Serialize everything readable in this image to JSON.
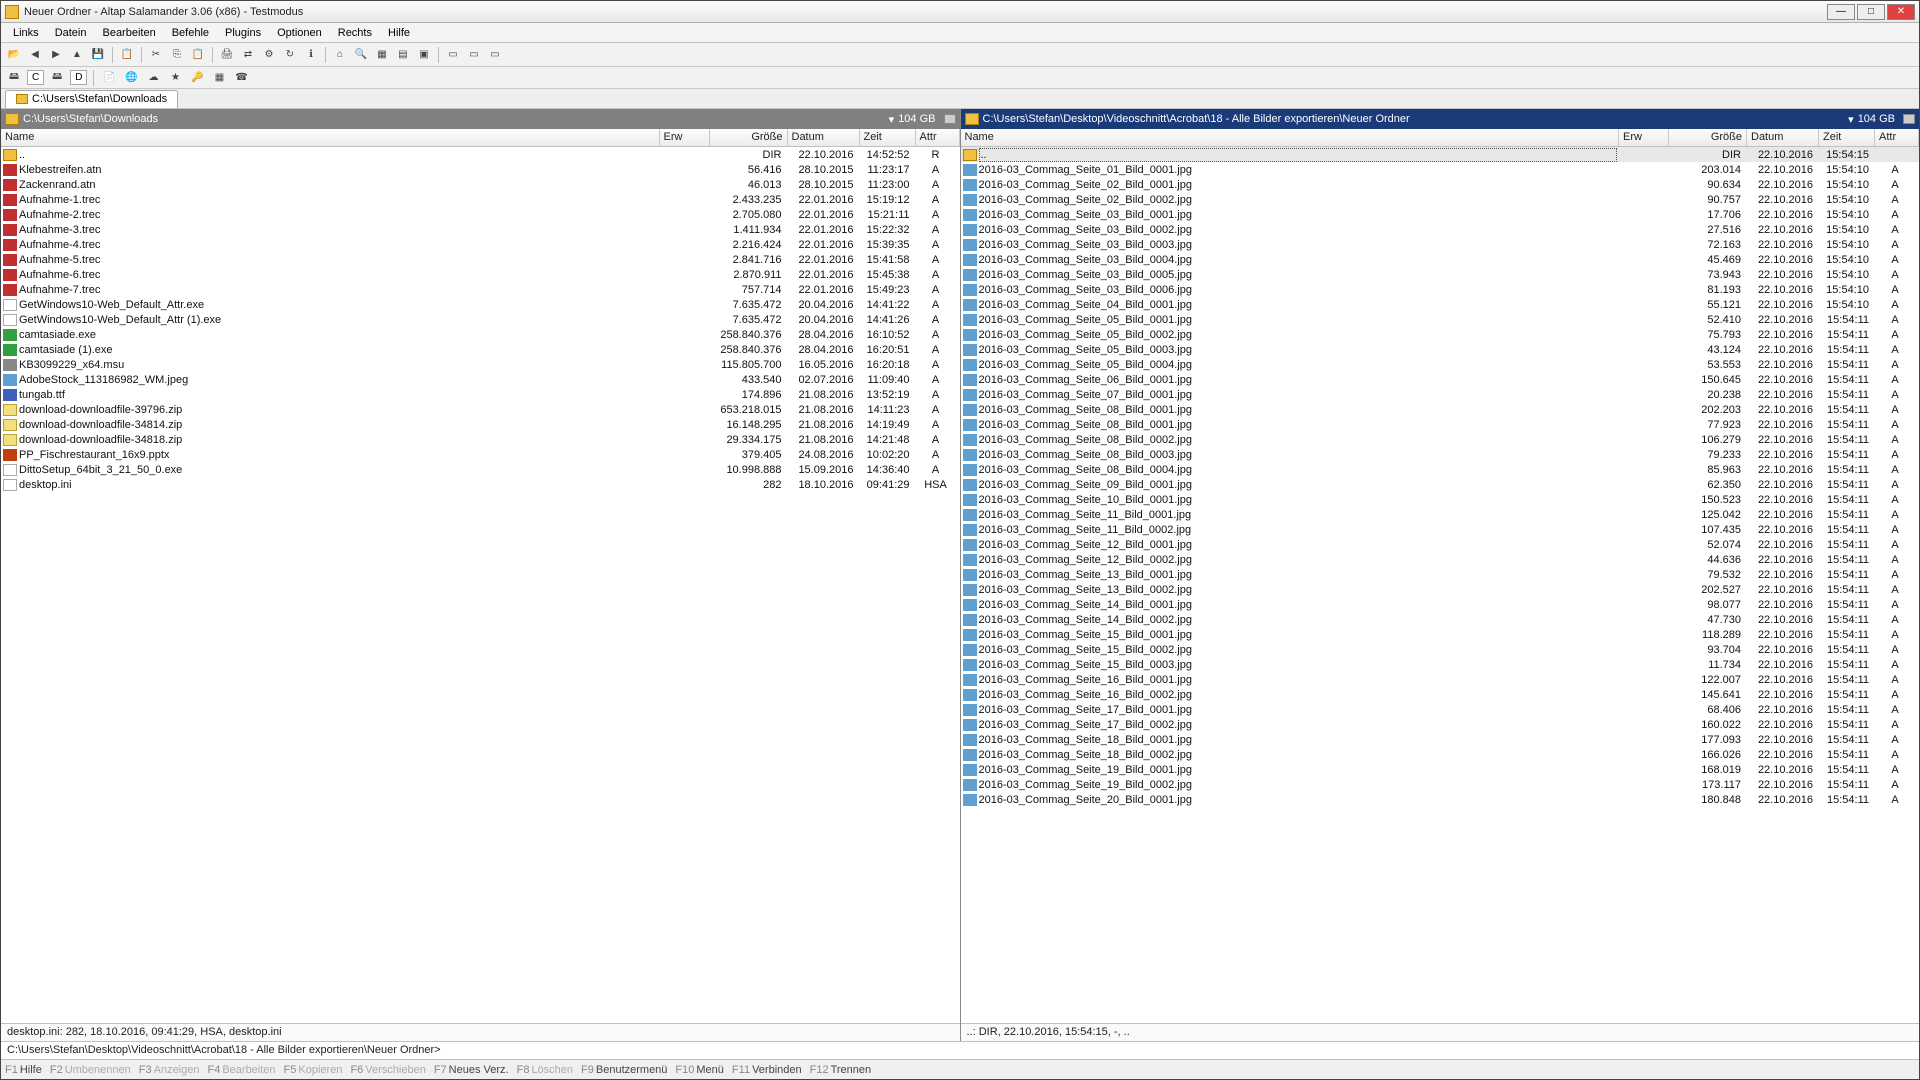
{
  "title": "Neuer Ordner - Altap Salamander 3.06 (x86) - Testmodus",
  "menu": [
    "Links",
    "Datein",
    "Bearbeiten",
    "Befehle",
    "Plugins",
    "Optionen",
    "Rechts",
    "Hilfe"
  ],
  "drives": [
    "C",
    "D"
  ],
  "tab_left": "C:\\Users\\Stefan\\Downloads",
  "left": {
    "path": "C:\\Users\\Stefan\\Downloads",
    "free": "104 GB",
    "cols": [
      "Name",
      "Erw",
      "Größe",
      "Datum",
      "Zeit",
      "Attr"
    ],
    "rows": [
      {
        "ic": "up",
        "nm": "..",
        "sz": "DIR",
        "dt": "22.10.2016",
        "tm": "14:52:52",
        "at": "R"
      },
      {
        "ic": "red",
        "nm": "Klebestreifen.atn",
        "sz": "56.416",
        "dt": "28.10.2015",
        "tm": "11:23:17",
        "at": "A"
      },
      {
        "ic": "red",
        "nm": "Zackenrand.atn",
        "sz": "46.013",
        "dt": "28.10.2015",
        "tm": "11:23:00",
        "at": "A"
      },
      {
        "ic": "red",
        "nm": "Aufnahme-1.trec",
        "sz": "2.433.235",
        "dt": "22.01.2016",
        "tm": "15:19:12",
        "at": "A"
      },
      {
        "ic": "red",
        "nm": "Aufnahme-2.trec",
        "sz": "2.705.080",
        "dt": "22.01.2016",
        "tm": "15:21:11",
        "at": "A"
      },
      {
        "ic": "red",
        "nm": "Aufnahme-3.trec",
        "sz": "1.411.934",
        "dt": "22.01.2016",
        "tm": "15:22:32",
        "at": "A"
      },
      {
        "ic": "red",
        "nm": "Aufnahme-4.trec",
        "sz": "2.216.424",
        "dt": "22.01.2016",
        "tm": "15:39:35",
        "at": "A"
      },
      {
        "ic": "red",
        "nm": "Aufnahme-5.trec",
        "sz": "2.841.716",
        "dt": "22.01.2016",
        "tm": "15:41:58",
        "at": "A"
      },
      {
        "ic": "red",
        "nm": "Aufnahme-6.trec",
        "sz": "2.870.911",
        "dt": "22.01.2016",
        "tm": "15:45:38",
        "at": "A"
      },
      {
        "ic": "red",
        "nm": "Aufnahme-7.trec",
        "sz": "757.714",
        "dt": "22.01.2016",
        "tm": "15:49:23",
        "at": "A"
      },
      {
        "ic": "white",
        "nm": "GetWindows10-Web_Default_Attr.exe",
        "sz": "7.635.472",
        "dt": "20.04.2016",
        "tm": "14:41:22",
        "at": "A"
      },
      {
        "ic": "white",
        "nm": "GetWindows10-Web_Default_Attr (1).exe",
        "sz": "7.635.472",
        "dt": "20.04.2016",
        "tm": "14:41:26",
        "at": "A"
      },
      {
        "ic": "green",
        "nm": "camtasiade.exe",
        "sz": "258.840.376",
        "dt": "28.04.2016",
        "tm": "16:10:52",
        "at": "A"
      },
      {
        "ic": "green",
        "nm": "camtasiade (1).exe",
        "sz": "258.840.376",
        "dt": "28.04.2016",
        "tm": "16:20:51",
        "at": "A"
      },
      {
        "ic": "wrench",
        "nm": "KB3099229_x64.msu",
        "sz": "115.805.700",
        "dt": "16.05.2016",
        "tm": "16:20:18",
        "at": "A"
      },
      {
        "ic": "img",
        "nm": "AdobeStock_113186982_WM.jpeg",
        "sz": "433.540",
        "dt": "02.07.2016",
        "tm": "11:09:40",
        "at": "A"
      },
      {
        "ic": "blue",
        "nm": "tungab.ttf",
        "sz": "174.896",
        "dt": "21.08.2016",
        "tm": "13:52:19",
        "at": "A"
      },
      {
        "ic": "zip",
        "nm": "download-downloadfile-39796.zip",
        "sz": "653.218.015",
        "dt": "21.08.2016",
        "tm": "14:11:23",
        "at": "A"
      },
      {
        "ic": "zip",
        "nm": "download-downloadfile-34814.zip",
        "sz": "16.148.295",
        "dt": "21.08.2016",
        "tm": "14:19:49",
        "at": "A"
      },
      {
        "ic": "zip",
        "nm": "download-downloadfile-34818.zip",
        "sz": "29.334.175",
        "dt": "21.08.2016",
        "tm": "14:21:48",
        "at": "A"
      },
      {
        "ic": "pp",
        "nm": "PP_Fischrestaurant_16x9.pptx",
        "sz": "379.405",
        "dt": "24.08.2016",
        "tm": "10:02:20",
        "at": "A"
      },
      {
        "ic": "white",
        "nm": "DittoSetup_64bit_3_21_50_0.exe",
        "sz": "10.998.888",
        "dt": "15.09.2016",
        "tm": "14:36:40",
        "at": "A"
      },
      {
        "ic": "white",
        "nm": "desktop.ini",
        "sz": "282",
        "dt": "18.10.2016",
        "tm": "09:41:29",
        "at": "HSA"
      }
    ],
    "info1": "desktop.ini: 282, 18.10.2016, 09:41:29, HSA, desktop.ini"
  },
  "right": {
    "path": "C:\\Users\\Stefan\\Desktop\\Videoschnitt\\Acrobat\\18 - Alle Bilder exportieren\\Neuer Ordner",
    "free": "104 GB",
    "cols": [
      "Name",
      "Erw",
      "Größe",
      "Datum",
      "Zeit",
      "Attr"
    ],
    "rows": [
      {
        "ic": "up",
        "nm": "..",
        "sz": "DIR",
        "dt": "22.10.2016",
        "tm": "15:54:15",
        "at": "",
        "sel": true
      },
      {
        "ic": "img",
        "nm": "2016-03_Commag_Seite_01_Bild_0001.jpg",
        "sz": "203.014",
        "dt": "22.10.2016",
        "tm": "15:54:10",
        "at": "A"
      },
      {
        "ic": "img",
        "nm": "2016-03_Commag_Seite_02_Bild_0001.jpg",
        "sz": "90.634",
        "dt": "22.10.2016",
        "tm": "15:54:10",
        "at": "A"
      },
      {
        "ic": "img",
        "nm": "2016-03_Commag_Seite_02_Bild_0002.jpg",
        "sz": "90.757",
        "dt": "22.10.2016",
        "tm": "15:54:10",
        "at": "A"
      },
      {
        "ic": "img",
        "nm": "2016-03_Commag_Seite_03_Bild_0001.jpg",
        "sz": "17.706",
        "dt": "22.10.2016",
        "tm": "15:54:10",
        "at": "A"
      },
      {
        "ic": "img",
        "nm": "2016-03_Commag_Seite_03_Bild_0002.jpg",
        "sz": "27.516",
        "dt": "22.10.2016",
        "tm": "15:54:10",
        "at": "A"
      },
      {
        "ic": "img",
        "nm": "2016-03_Commag_Seite_03_Bild_0003.jpg",
        "sz": "72.163",
        "dt": "22.10.2016",
        "tm": "15:54:10",
        "at": "A"
      },
      {
        "ic": "img",
        "nm": "2016-03_Commag_Seite_03_Bild_0004.jpg",
        "sz": "45.469",
        "dt": "22.10.2016",
        "tm": "15:54:10",
        "at": "A"
      },
      {
        "ic": "img",
        "nm": "2016-03_Commag_Seite_03_Bild_0005.jpg",
        "sz": "73.943",
        "dt": "22.10.2016",
        "tm": "15:54:10",
        "at": "A"
      },
      {
        "ic": "img",
        "nm": "2016-03_Commag_Seite_03_Bild_0006.jpg",
        "sz": "81.193",
        "dt": "22.10.2016",
        "tm": "15:54:10",
        "at": "A"
      },
      {
        "ic": "img",
        "nm": "2016-03_Commag_Seite_04_Bild_0001.jpg",
        "sz": "55.121",
        "dt": "22.10.2016",
        "tm": "15:54:10",
        "at": "A"
      },
      {
        "ic": "img",
        "nm": "2016-03_Commag_Seite_05_Bild_0001.jpg",
        "sz": "52.410",
        "dt": "22.10.2016",
        "tm": "15:54:11",
        "at": "A"
      },
      {
        "ic": "img",
        "nm": "2016-03_Commag_Seite_05_Bild_0002.jpg",
        "sz": "75.793",
        "dt": "22.10.2016",
        "tm": "15:54:11",
        "at": "A"
      },
      {
        "ic": "img",
        "nm": "2016-03_Commag_Seite_05_Bild_0003.jpg",
        "sz": "43.124",
        "dt": "22.10.2016",
        "tm": "15:54:11",
        "at": "A"
      },
      {
        "ic": "img",
        "nm": "2016-03_Commag_Seite_05_Bild_0004.jpg",
        "sz": "53.553",
        "dt": "22.10.2016",
        "tm": "15:54:11",
        "at": "A"
      },
      {
        "ic": "img",
        "nm": "2016-03_Commag_Seite_06_Bild_0001.jpg",
        "sz": "150.645",
        "dt": "22.10.2016",
        "tm": "15:54:11",
        "at": "A"
      },
      {
        "ic": "img",
        "nm": "2016-03_Commag_Seite_07_Bild_0001.jpg",
        "sz": "20.238",
        "dt": "22.10.2016",
        "tm": "15:54:11",
        "at": "A"
      },
      {
        "ic": "img",
        "nm": "2016-03_Commag_Seite_08_Bild_0001.jpg",
        "sz": "202.203",
        "dt": "22.10.2016",
        "tm": "15:54:11",
        "at": "A"
      },
      {
        "ic": "img",
        "nm": "2016-03_Commag_Seite_08_Bild_0001.jpg",
        "sz": "77.923",
        "dt": "22.10.2016",
        "tm": "15:54:11",
        "at": "A"
      },
      {
        "ic": "img",
        "nm": "2016-03_Commag_Seite_08_Bild_0002.jpg",
        "sz": "106.279",
        "dt": "22.10.2016",
        "tm": "15:54:11",
        "at": "A"
      },
      {
        "ic": "img",
        "nm": "2016-03_Commag_Seite_08_Bild_0003.jpg",
        "sz": "79.233",
        "dt": "22.10.2016",
        "tm": "15:54:11",
        "at": "A"
      },
      {
        "ic": "img",
        "nm": "2016-03_Commag_Seite_08_Bild_0004.jpg",
        "sz": "85.963",
        "dt": "22.10.2016",
        "tm": "15:54:11",
        "at": "A"
      },
      {
        "ic": "img",
        "nm": "2016-03_Commag_Seite_09_Bild_0001.jpg",
        "sz": "62.350",
        "dt": "22.10.2016",
        "tm": "15:54:11",
        "at": "A"
      },
      {
        "ic": "img",
        "nm": "2016-03_Commag_Seite_10_Bild_0001.jpg",
        "sz": "150.523",
        "dt": "22.10.2016",
        "tm": "15:54:11",
        "at": "A"
      },
      {
        "ic": "img",
        "nm": "2016-03_Commag_Seite_11_Bild_0001.jpg",
        "sz": "125.042",
        "dt": "22.10.2016",
        "tm": "15:54:11",
        "at": "A"
      },
      {
        "ic": "img",
        "nm": "2016-03_Commag_Seite_11_Bild_0002.jpg",
        "sz": "107.435",
        "dt": "22.10.2016",
        "tm": "15:54:11",
        "at": "A"
      },
      {
        "ic": "img",
        "nm": "2016-03_Commag_Seite_12_Bild_0001.jpg",
        "sz": "52.074",
        "dt": "22.10.2016",
        "tm": "15:54:11",
        "at": "A"
      },
      {
        "ic": "img",
        "nm": "2016-03_Commag_Seite_12_Bild_0002.jpg",
        "sz": "44.636",
        "dt": "22.10.2016",
        "tm": "15:54:11",
        "at": "A"
      },
      {
        "ic": "img",
        "nm": "2016-03_Commag_Seite_13_Bild_0001.jpg",
        "sz": "79.532",
        "dt": "22.10.2016",
        "tm": "15:54:11",
        "at": "A"
      },
      {
        "ic": "img",
        "nm": "2016-03_Commag_Seite_13_Bild_0002.jpg",
        "sz": "202.527",
        "dt": "22.10.2016",
        "tm": "15:54:11",
        "at": "A"
      },
      {
        "ic": "img",
        "nm": "2016-03_Commag_Seite_14_Bild_0001.jpg",
        "sz": "98.077",
        "dt": "22.10.2016",
        "tm": "15:54:11",
        "at": "A"
      },
      {
        "ic": "img",
        "nm": "2016-03_Commag_Seite_14_Bild_0002.jpg",
        "sz": "47.730",
        "dt": "22.10.2016",
        "tm": "15:54:11",
        "at": "A"
      },
      {
        "ic": "img",
        "nm": "2016-03_Commag_Seite_15_Bild_0001.jpg",
        "sz": "118.289",
        "dt": "22.10.2016",
        "tm": "15:54:11",
        "at": "A"
      },
      {
        "ic": "img",
        "nm": "2016-03_Commag_Seite_15_Bild_0002.jpg",
        "sz": "93.704",
        "dt": "22.10.2016",
        "tm": "15:54:11",
        "at": "A"
      },
      {
        "ic": "img",
        "nm": "2016-03_Commag_Seite_15_Bild_0003.jpg",
        "sz": "11.734",
        "dt": "22.10.2016",
        "tm": "15:54:11",
        "at": "A"
      },
      {
        "ic": "img",
        "nm": "2016-03_Commag_Seite_16_Bild_0001.jpg",
        "sz": "122.007",
        "dt": "22.10.2016",
        "tm": "15:54:11",
        "at": "A"
      },
      {
        "ic": "img",
        "nm": "2016-03_Commag_Seite_16_Bild_0002.jpg",
        "sz": "145.641",
        "dt": "22.10.2016",
        "tm": "15:54:11",
        "at": "A"
      },
      {
        "ic": "img",
        "nm": "2016-03_Commag_Seite_17_Bild_0001.jpg",
        "sz": "68.406",
        "dt": "22.10.2016",
        "tm": "15:54:11",
        "at": "A"
      },
      {
        "ic": "img",
        "nm": "2016-03_Commag_Seite_17_Bild_0002.jpg",
        "sz": "160.022",
        "dt": "22.10.2016",
        "tm": "15:54:11",
        "at": "A"
      },
      {
        "ic": "img",
        "nm": "2016-03_Commag_Seite_18_Bild_0001.jpg",
        "sz": "177.093",
        "dt": "22.10.2016",
        "tm": "15:54:11",
        "at": "A"
      },
      {
        "ic": "img",
        "nm": "2016-03_Commag_Seite_18_Bild_0002.jpg",
        "sz": "166.026",
        "dt": "22.10.2016",
        "tm": "15:54:11",
        "at": "A"
      },
      {
        "ic": "img",
        "nm": "2016-03_Commag_Seite_19_Bild_0001.jpg",
        "sz": "168.019",
        "dt": "22.10.2016",
        "tm": "15:54:11",
        "at": "A"
      },
      {
        "ic": "img",
        "nm": "2016-03_Commag_Seite_19_Bild_0002.jpg",
        "sz": "173.117",
        "dt": "22.10.2016",
        "tm": "15:54:11",
        "at": "A"
      },
      {
        "ic": "img",
        "nm": "2016-03_Commag_Seite_20_Bild_0001.jpg",
        "sz": "180.848",
        "dt": "22.10.2016",
        "tm": "15:54:11",
        "at": "A"
      }
    ],
    "info1": "..: DIR, 22.10.2016, 15:54:15, -, .."
  },
  "cmdline": "C:\\Users\\Stefan\\Desktop\\Videoschnitt\\Acrobat\\18 - Alle Bilder exportieren\\Neuer Ordner>",
  "fkeys": [
    {
      "k": "F1",
      "t": "Hilfe",
      "en": true
    },
    {
      "k": "F2",
      "t": "Umbenennen",
      "en": false
    },
    {
      "k": "F3",
      "t": "Anzeigen",
      "en": false
    },
    {
      "k": "F4",
      "t": "Bearbeiten",
      "en": false
    },
    {
      "k": "F5",
      "t": "Kopieren",
      "en": false
    },
    {
      "k": "F6",
      "t": "Verschieben",
      "en": false
    },
    {
      "k": "F7",
      "t": "Neues Verz.",
      "en": true
    },
    {
      "k": "F8",
      "t": "Löschen",
      "en": false
    },
    {
      "k": "F9",
      "t": "Benutzermenü",
      "en": true
    },
    {
      "k": "F10",
      "t": "Menü",
      "en": true
    },
    {
      "k": "F11",
      "t": "Verbinden",
      "en": true
    },
    {
      "k": "F12",
      "t": "Trennen",
      "en": true
    }
  ]
}
